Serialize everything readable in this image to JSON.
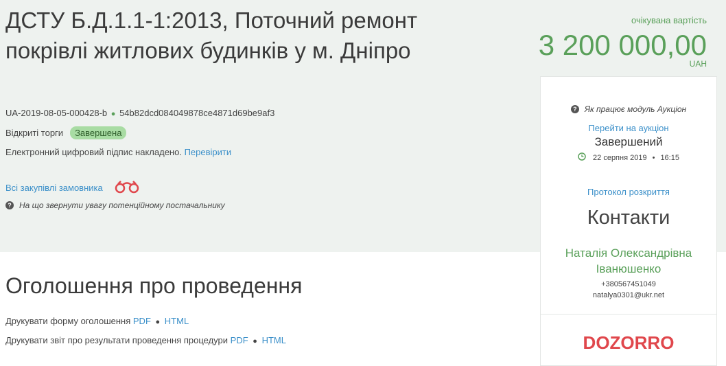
{
  "tender": {
    "title": "ДСТУ Б.Д.1.1-1:2013, Поточний ремонт покрівлі житлових будинків у м. Дніпро",
    "id": "UA-2019-08-05-000428-b",
    "hash": "54b82dcd084049878ce4871d69be9af3",
    "procedure_type": "Відкриті торги",
    "status": "Завершена",
    "signature_text": "Електронний цифровий підпис накладено.",
    "signature_link": "Перевірити",
    "all_purchases_link": "Всі закупівлі замовника",
    "supplier_hint": "На що звернути увагу потенційному постачальнику"
  },
  "cost": {
    "label": "очікувана вартість",
    "value": "3 200 000,00",
    "currency": "UAH"
  },
  "sidebar": {
    "auction_help": "Як працює модуль Аукціон",
    "goto_auction": "Перейти на аукціон",
    "auction_status": "Завершений",
    "auction_date": "22 серпня 2019",
    "auction_time": "16:15",
    "protocol_link": "Протокол розкриття",
    "contacts_heading": "Контакти",
    "contact_name": "Наталія Олександрівна Іванюшенко",
    "phone": "+380567451049",
    "email": "natalya0301@ukr.net",
    "logo_text": "DOZORRO"
  },
  "announcement": {
    "heading": "Оголошення про проведення",
    "print_form_label": "Друкувати форму оголошення",
    "print_report_label": "Друкувати звіт про результати проведення процедури",
    "pdf": "PDF",
    "html": "HTML"
  },
  "colors": {
    "accent_green": "#5aa05a",
    "link_blue": "#3a8fc9",
    "badge_bg": "#a8dca3",
    "logo_red": "#e0474c"
  }
}
